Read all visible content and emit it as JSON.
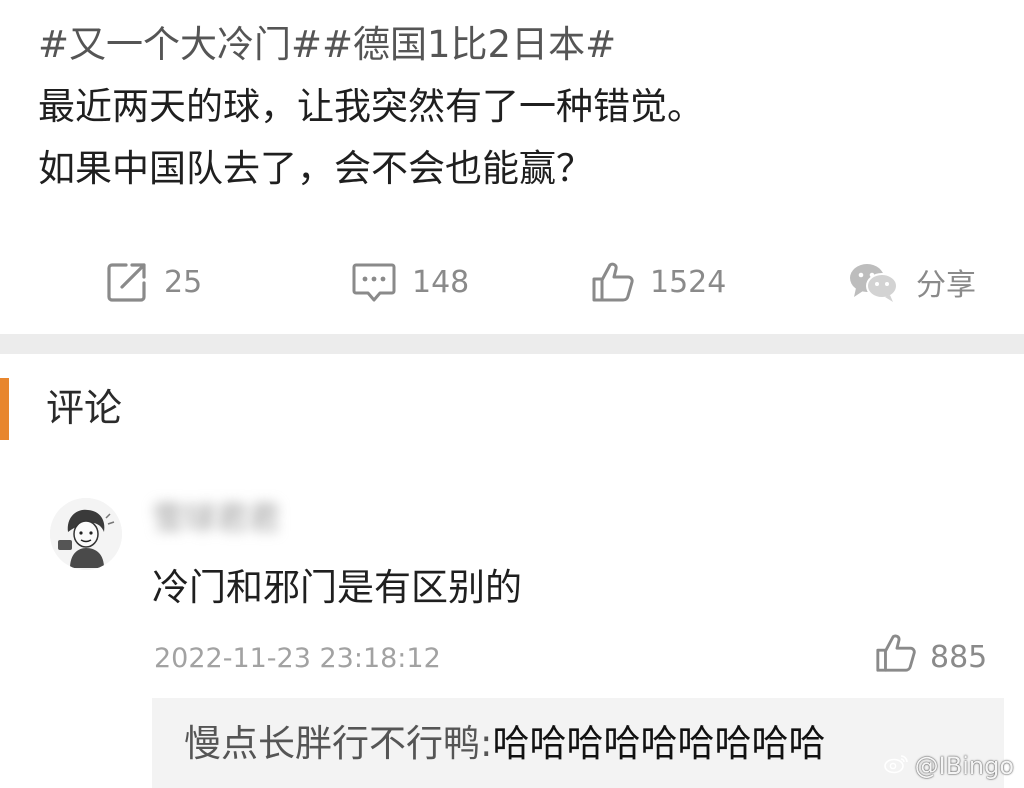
{
  "post": {
    "lines": [
      "#又一个大冷门##德国1比2日本#",
      "最近两天的球，让我突然有了一种错觉。",
      "如果中国队去了，会不会也能赢？"
    ],
    "actions": {
      "repost_count": "25",
      "comment_count": "148",
      "like_count": "1524",
      "share_label": "分享"
    }
  },
  "comments": {
    "title": "评论",
    "items": [
      {
        "username": "雪球君君",
        "text": "冷门和邪门是有区别的",
        "time": "2022-11-23 23:18:12",
        "likes": "885",
        "reply": {
          "user": "慢点长胖行不行鸭:",
          "text": "哈哈哈哈哈哈哈哈哈"
        }
      }
    ]
  },
  "watermark": {
    "text": "@IBingo",
    "icon": "weibo-icon"
  },
  "colors": {
    "accent": "#e8862e",
    "divider": "#ececec",
    "muted": "#8a8a8a",
    "reply_bg": "#f3f3f3"
  }
}
